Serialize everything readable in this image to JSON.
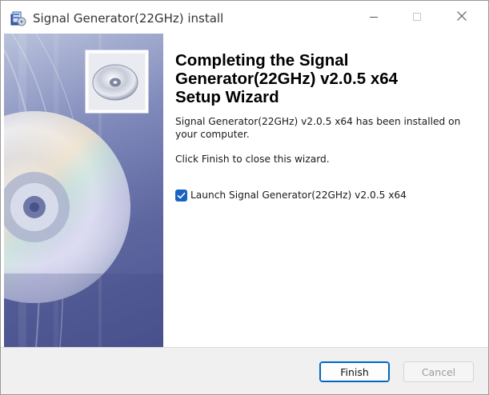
{
  "window": {
    "title": "Signal Generator(22GHz) install",
    "icon": "installer-app-icon",
    "controls": {
      "minimize": "minimize-icon",
      "maximize": "maximize-icon",
      "close": "close-icon"
    }
  },
  "banner": {
    "image": "cd-disc-banner"
  },
  "main": {
    "heading_lines": [
      "Completing the Signal",
      "Generator(22GHz) v2.0.5 x64",
      "Setup Wizard"
    ],
    "description": "Signal Generator(22GHz) v2.0.5 x64 has been installed on your computer.",
    "close_hint": "Click Finish to close this wizard.",
    "launch_checkbox": {
      "label": "Launch Signal Generator(22GHz) v2.0.5 x64",
      "checked": true
    }
  },
  "footer": {
    "finish_label": "Finish",
    "cancel_label": "Cancel",
    "cancel_enabled": false
  },
  "colors": {
    "accent": "#0067c0",
    "checkbox": "#1a63c2",
    "banner": "#6670a8"
  }
}
